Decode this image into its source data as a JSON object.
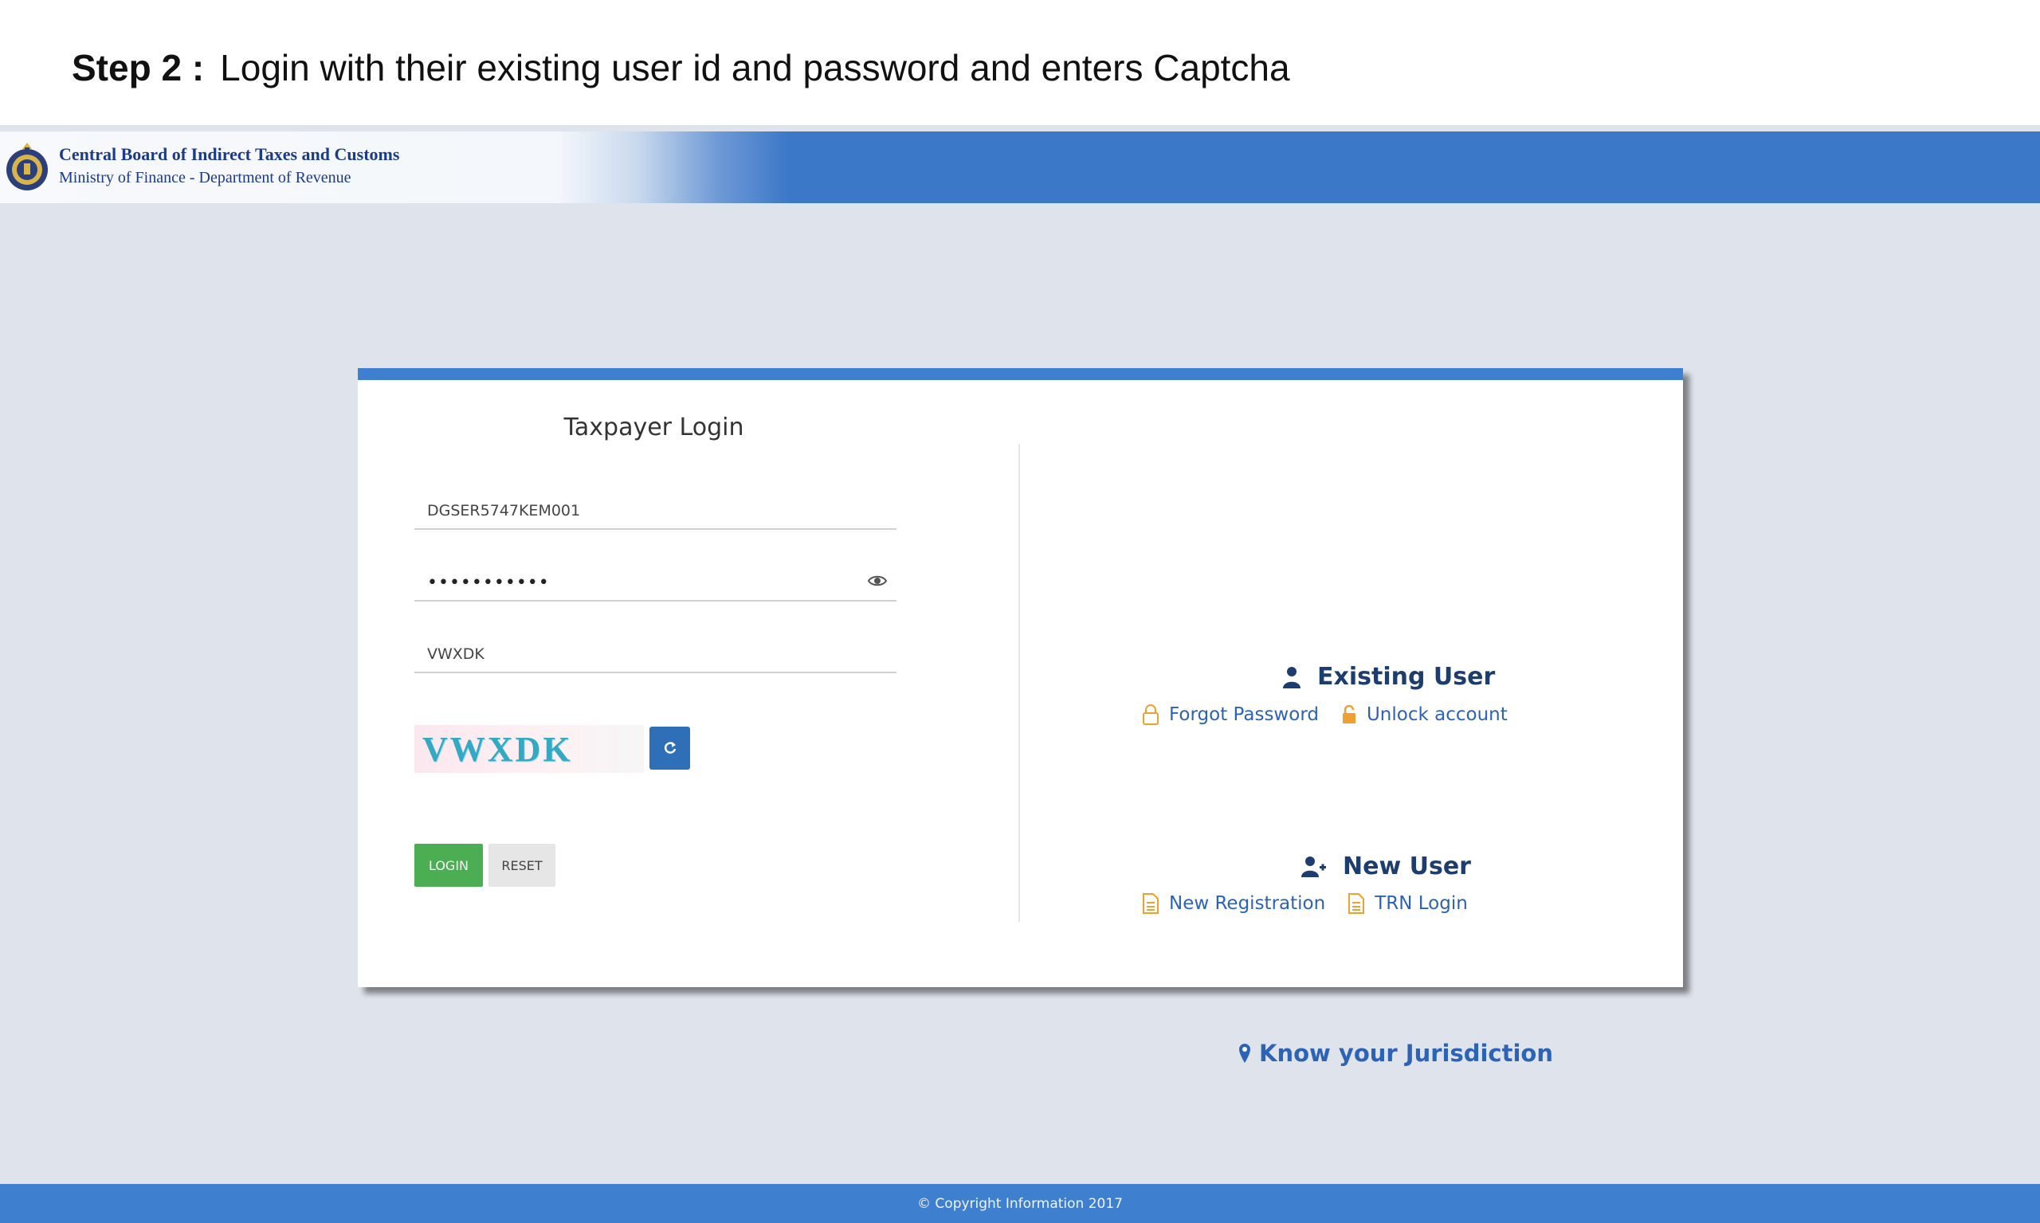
{
  "slide": {
    "step_label": "Step 2 :",
    "title": "Login with their existing user id and password and enters Captcha"
  },
  "header": {
    "org_name": "Central Board of Indirect Taxes and Customs",
    "org_sub": "Ministry of Finance - Department of Revenue",
    "logo_icon": "emblem-icon"
  },
  "login": {
    "title": "Taxpayer Login",
    "user_id_value": "DGSER5747KEM001",
    "password_value": "•••••••••••",
    "captcha_value": "VWXDK",
    "captcha_image_text": "VWXDK",
    "login_label": "LOGIN",
    "reset_label": "RESET"
  },
  "existing_user": {
    "title": "Existing User",
    "forgot_password": "Forgot Password",
    "unlock_account": "Unlock account"
  },
  "new_user": {
    "title": "New User",
    "new_registration": "New Registration",
    "trn_login": "TRN Login"
  },
  "jurisdiction": "Know your Jurisdiction",
  "footer": "© Copyright Information 2017",
  "colors": {
    "accent_blue": "#3f7fd0",
    "login_green": "#4cae52",
    "link_blue": "#2d63b4",
    "icon_orange": "#f0a030",
    "heading_navy": "#1d3d6e"
  }
}
